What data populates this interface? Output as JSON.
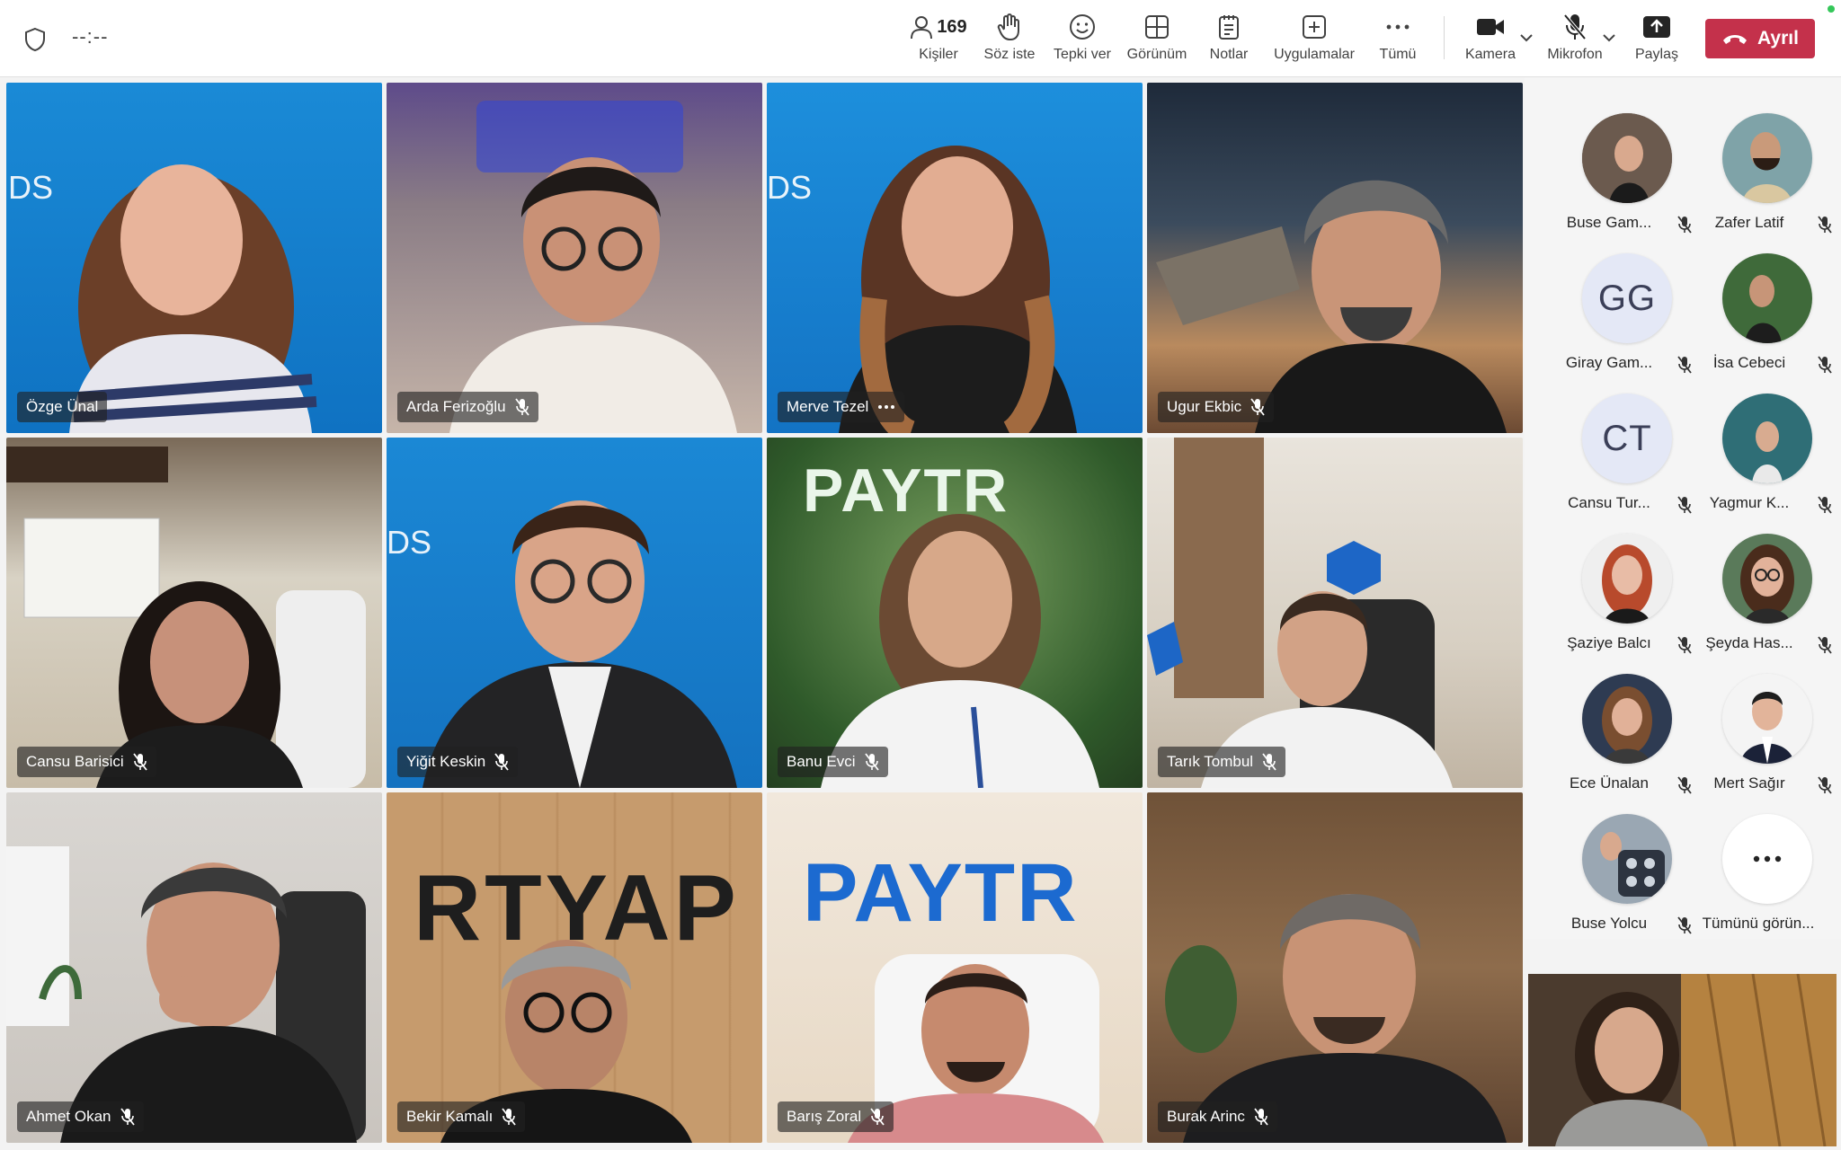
{
  "meeting": {
    "timer": "--:--"
  },
  "toolbar": {
    "people_count": "169",
    "people_label": "Kişiler",
    "raise_hand_label": "Söz iste",
    "react_label": "Tepki ver",
    "view_label": "Görünüm",
    "notes_label": "Notlar",
    "apps_label": "Uygulamalar",
    "more_label": "Tümü",
    "camera_label": "Kamera",
    "mic_label": "Mikrofon",
    "share_label": "Paylaş",
    "leave_label": "Ayrıl"
  },
  "tiles": [
    {
      "name": "Özge Ünal",
      "muted": false
    },
    {
      "name": "Arda Ferizoğlu",
      "muted": true
    },
    {
      "name": "Merve Tezel",
      "muted": false,
      "more": true
    },
    {
      "name": "Ugur Ekbic",
      "muted": true
    },
    {
      "name": "Cansu Barisici",
      "muted": true
    },
    {
      "name": "Yiğit Keskin",
      "muted": true
    },
    {
      "name": "Banu Evci",
      "muted": true
    },
    {
      "name": "Tarık Tombul",
      "muted": true
    },
    {
      "name": "Ahmet Okan",
      "muted": true
    },
    {
      "name": "Bekir Kamalı",
      "muted": true
    },
    {
      "name": "Barış Zoral",
      "muted": true
    },
    {
      "name": "Burak Arinc",
      "muted": true
    }
  ],
  "tile_backdrop_text": {
    "brand": "PAYTR",
    "brand_mirrored": "RTYAP",
    "wall_text": "DS"
  },
  "panel": {
    "participants": [
      {
        "name": "Buse Gam...",
        "avatar": "photo"
      },
      {
        "name": "Zafer Latif",
        "avatar": "photo"
      },
      {
        "name": "Giray Gam...",
        "avatar": "initials",
        "initials": "GG"
      },
      {
        "name": "İsa Cebeci",
        "avatar": "photo"
      },
      {
        "name": "Cansu Tur...",
        "avatar": "initials",
        "initials": "CT"
      },
      {
        "name": "Yagmur K...",
        "avatar": "photo"
      },
      {
        "name": "Şaziye Balcı",
        "avatar": "photo"
      },
      {
        "name": "Şeyda Has...",
        "avatar": "photo"
      },
      {
        "name": "Ece Ünalan",
        "avatar": "photo"
      },
      {
        "name": "Mert Sağır",
        "avatar": "photo"
      },
      {
        "name": "Buse Yolcu",
        "avatar": "photo"
      }
    ],
    "see_all_label": "Tümünü görün..."
  },
  "colors": {
    "leave_button": "#c4314b",
    "initials_avatar": "#e4e8f6",
    "status_dot": "#34c759"
  }
}
